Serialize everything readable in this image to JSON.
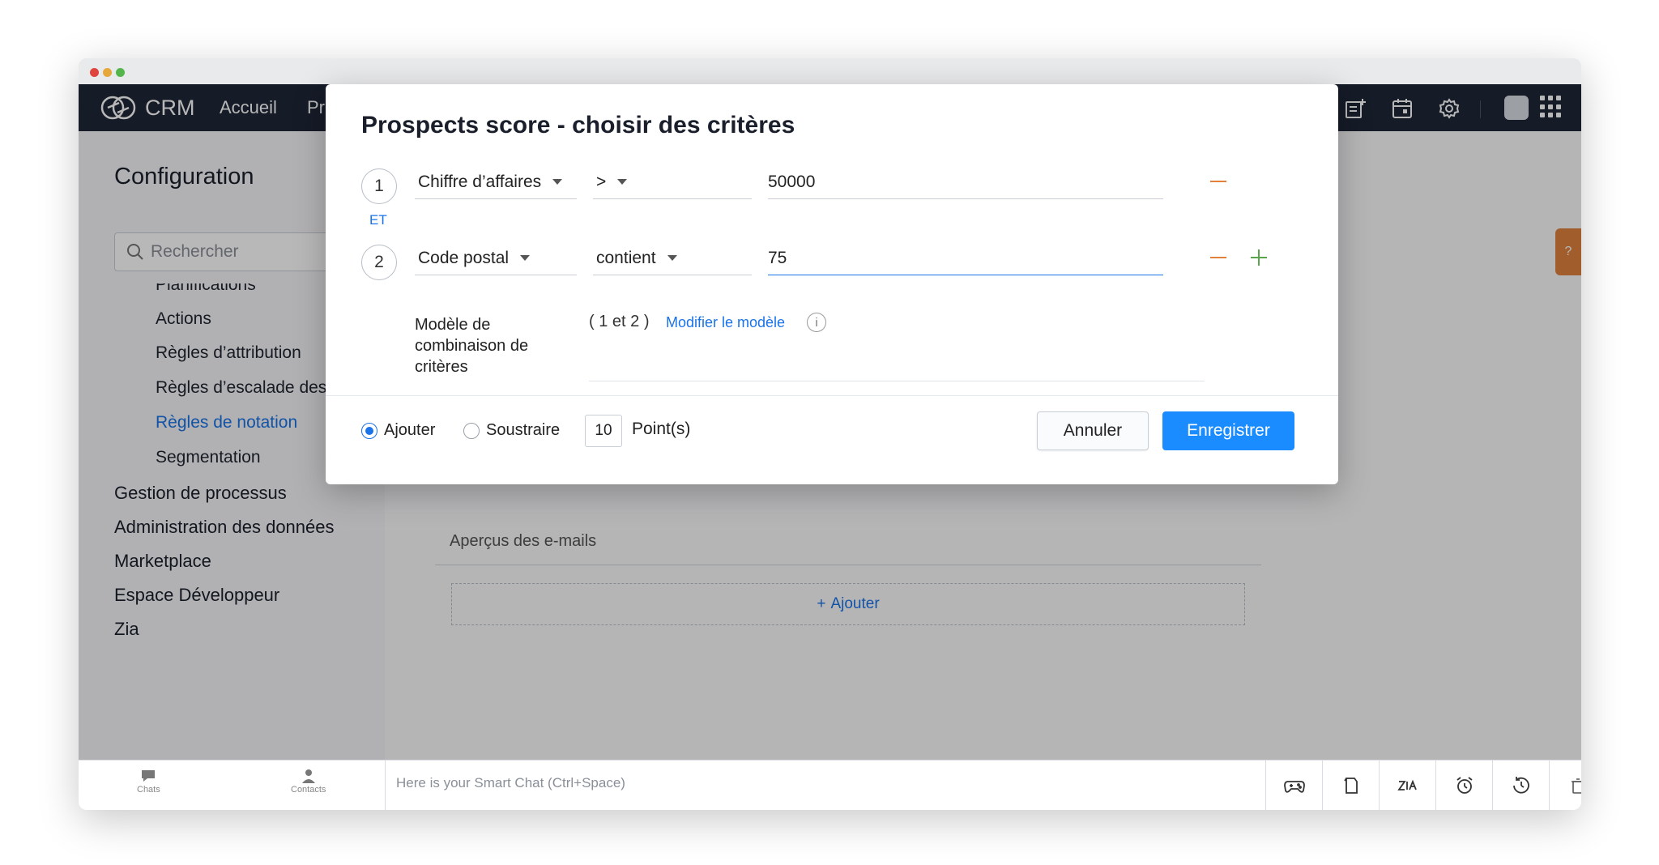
{
  "app": {
    "brand": "CRM",
    "nav": [
      "Accueil",
      "Pr"
    ]
  },
  "sidebar": {
    "title": "Configuration",
    "search_placeholder": "Rechercher",
    "partial_item": "Planifications",
    "items": [
      {
        "label": "Actions",
        "active": false
      },
      {
        "label": "Règles d’attribution",
        "active": false
      },
      {
        "label": "Règles d’escalade des c",
        "active": false
      },
      {
        "label": "Règles de notation",
        "active": true
      },
      {
        "label": "Segmentation",
        "active": false
      }
    ],
    "sections": [
      "Gestion de processus",
      "Administration des données",
      "Marketplace",
      "Espace Développeur",
      "Zia"
    ]
  },
  "content": {
    "previews_label": "Aperçus des e-mails",
    "add_label": "Ajouter",
    "help_icon": "?"
  },
  "modal": {
    "title": "Prospects score - choisir des critères",
    "criteria": [
      {
        "number": "1",
        "field": "Chiffre d’affaires",
        "operator": ">",
        "value": "50000"
      },
      {
        "number": "2",
        "field": "Code postal",
        "operator": "contient",
        "value": "75"
      }
    ],
    "connector": "ET",
    "pattern_label": "Modèle de combinaison de critères",
    "pattern_value": "( 1 et 2 )",
    "pattern_link": "Modifier le modèle",
    "info_glyph": "i",
    "radio_add": "Ajouter",
    "radio_subtract": "Soustraire",
    "points_value": "10",
    "points_label": "Point(s)",
    "cancel": "Annuler",
    "save": "Enregistrer"
  },
  "bottombar": {
    "chats": "Chats",
    "contacts": "Contacts",
    "smart_chat_placeholder": "Here is your Smart Chat (Ctrl+Space)"
  },
  "colors": {
    "topbar": "#1e2636",
    "accent": "#1a73e8",
    "save_button": "#1a8cff",
    "remove": "#e0823c",
    "add": "#5aa44c"
  }
}
